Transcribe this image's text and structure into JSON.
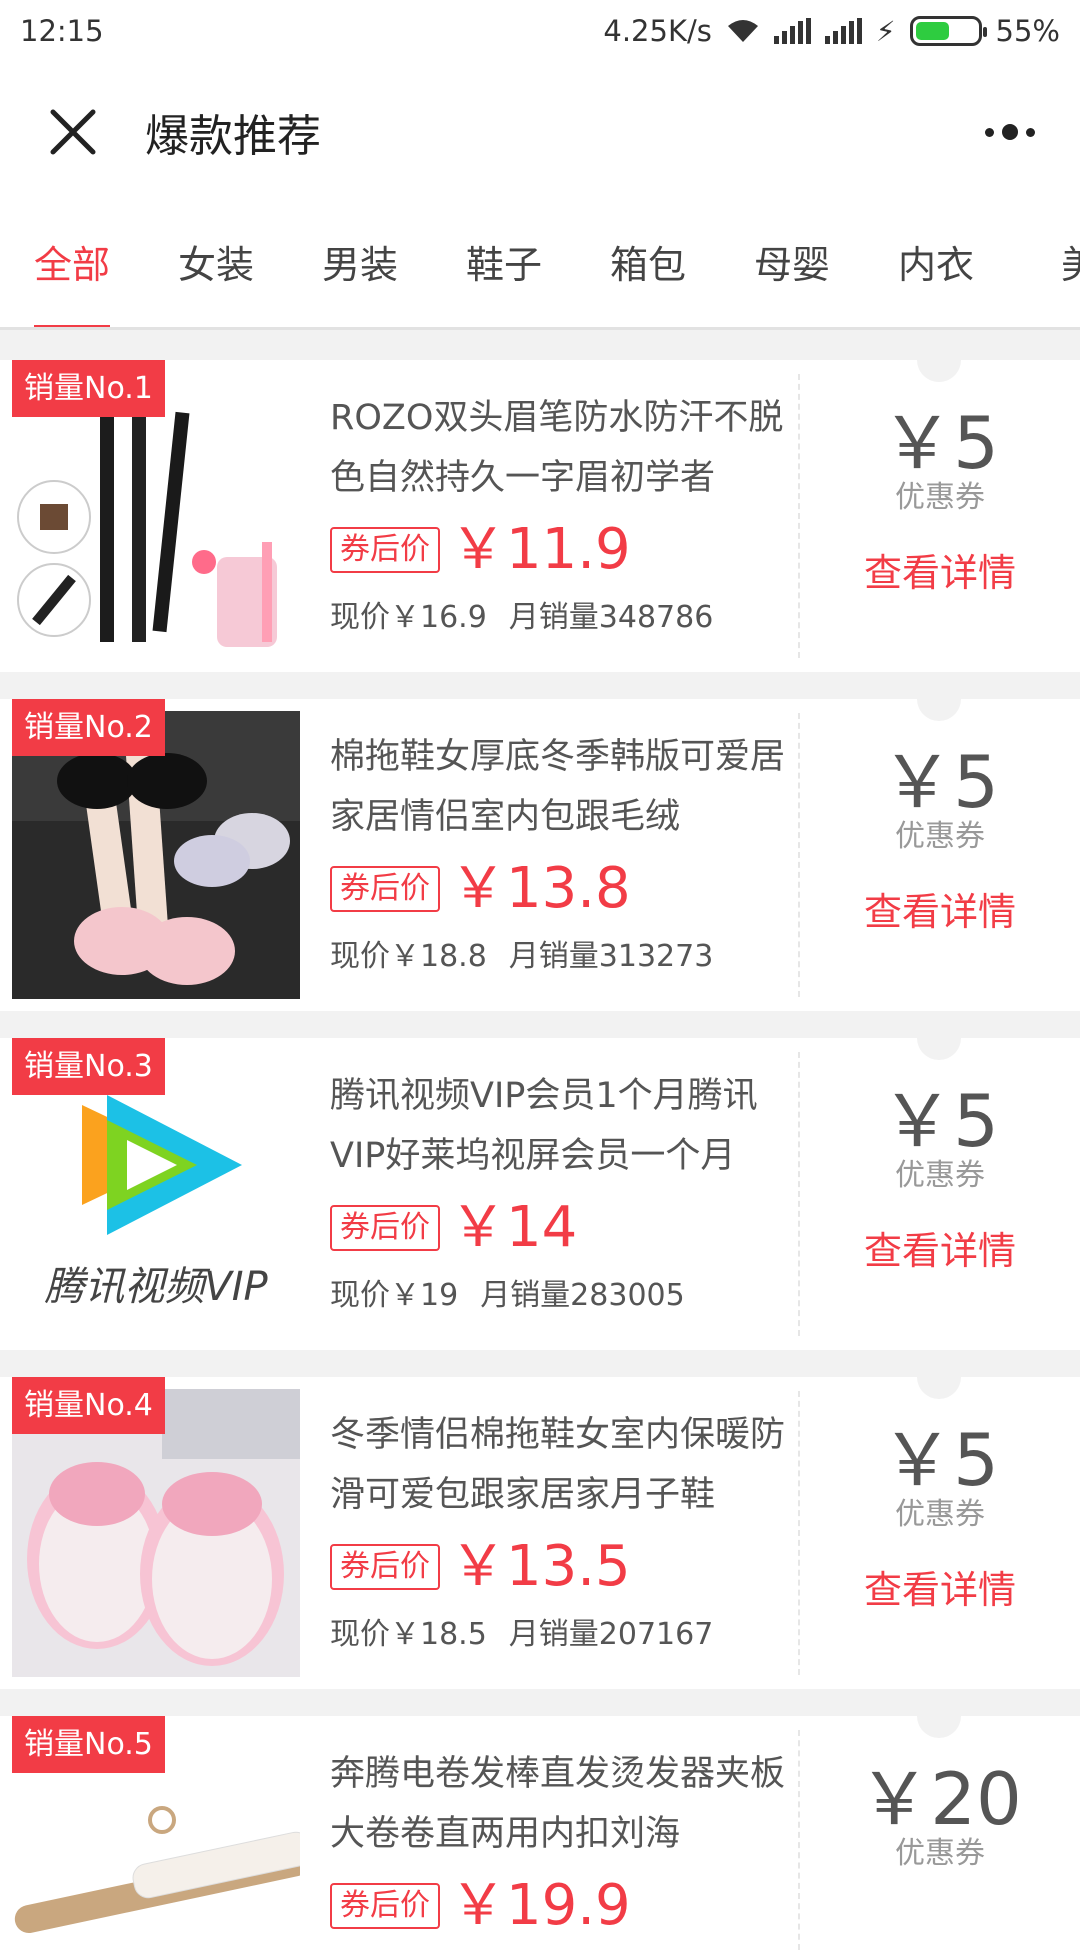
{
  "status": {
    "time": "12:15",
    "speed": "4.25K/s",
    "battery": "55%",
    "battery_level": 0.55
  },
  "header": {
    "title": "爆款推荐"
  },
  "tabs": [
    "全部",
    "女装",
    "男装",
    "鞋子",
    "箱包",
    "母婴",
    "内衣",
    "美"
  ],
  "labels": {
    "after_coupon": "券后价",
    "coupon": "优惠券",
    "detail": "查看详情"
  },
  "items": [
    {
      "badge": "销量No.1",
      "title": "ROZO双头眉笔防水防汗不脱色自然持久一字眉初学者",
      "price": "￥11.9",
      "current": "现价￥16.9",
      "sales": "月销量348786",
      "coupon": "￥5"
    },
    {
      "badge": "销量No.2",
      "title": "棉拖鞋女厚底冬季韩版可爱居家居情侣室内包跟毛绒",
      "price": "￥13.8",
      "current": "现价￥18.8",
      "sales": "月销量313273",
      "coupon": "￥5"
    },
    {
      "badge": "销量No.3",
      "title": "腾讯视频VIP会员1个月腾讯VIP好莱坞视屏会员一个月",
      "price": "￥14",
      "current": "现价￥19",
      "sales": "月销量283005",
      "coupon": "￥5"
    },
    {
      "badge": "销量No.4",
      "title": "冬季情侣棉拖鞋女室内保暖防滑可爱包跟家居家月子鞋",
      "price": "￥13.5",
      "current": "现价￥18.5",
      "sales": "月销量207167",
      "coupon": "￥5"
    },
    {
      "badge": "销量No.5",
      "title": "奔腾电卷发棒直发烫发器夹板大卷卷直两用内扣刘海",
      "price": "￥19.9",
      "current": "",
      "sales": "",
      "coupon": "￥20"
    }
  ],
  "thumb3_text": "腾讯视频VIP"
}
